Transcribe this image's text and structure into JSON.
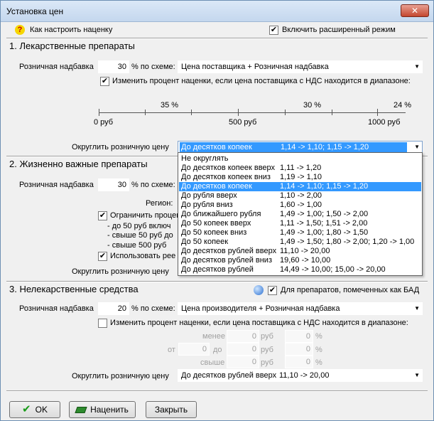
{
  "window": {
    "title": "Установка цен",
    "close_label": "✕"
  },
  "top": {
    "help_link": "Как настроить наценку",
    "help_icon": "question-icon",
    "extended_mode": {
      "label": "Включить расширенный режим",
      "checked": true
    }
  },
  "s1": {
    "header": "1. Лекарственные препараты",
    "markup_label": "Розничная надбавка",
    "markup_value": "30",
    "scheme_label": "% по схеме:",
    "scheme_value": "Цена поставщика + Розничная надбавка",
    "change_checkbox": {
      "label": "Изменить процент наценки, если цена поставщика с НДС находится в диапазоне:",
      "checked": true
    },
    "scale": {
      "percents": [
        "35 %",
        "30 %",
        "24 %"
      ],
      "prices": [
        "0 руб",
        "500 руб",
        "1000 руб"
      ]
    },
    "round_label": "Округлить розничную цену",
    "round_name": "До десятков копеек",
    "round_value": "1,14 -> 1,10;   1,15 -> 1,20"
  },
  "s2": {
    "header": "2. Жизненно важные препараты",
    "markup_label": "Розничная надбавка",
    "markup_value": "30",
    "scheme_label": "% по схеме:",
    "region_label": "Регион:",
    "limit_label": "Ограничить процен",
    "limit_checked": true,
    "lines": [
      "- до 50 руб  включ",
      "- свыше 50 руб до",
      "- свыше 500 руб"
    ],
    "use_label": "Использовать рее",
    "use_checked": true,
    "round_label": "Округлить розничную цену"
  },
  "dropdown": {
    "options": [
      {
        "name": "Не округлять",
        "value": ""
      },
      {
        "name": "До десятков копеек вверх",
        "value": "1,11 -> 1,20"
      },
      {
        "name": "До десятков копеек вниз",
        "value": "1,19 -> 1,10"
      },
      {
        "name": "До десятков копеек",
        "value": "1,14 -> 1,10;   1,15 -> 1,20"
      },
      {
        "name": "До рубля вверх",
        "value": "1,10 -> 2,00"
      },
      {
        "name": "До рубля вниз",
        "value": "1,60 -> 1,00"
      },
      {
        "name": "До ближайшего рубля",
        "value": "1,49 -> 1,00;   1,50 -> 2,00"
      },
      {
        "name": "До 50 копеек вверх",
        "value": "1,11 -> 1,50;   1,51 -> 2,00"
      },
      {
        "name": "До 50 копеек вниз",
        "value": "1,49 -> 1,00;   1,80 -> 1,50"
      },
      {
        "name": "До 50 копеек",
        "value": "1,49 -> 1,50;   1,80 -> 2,00;   1,20 -> 1,00"
      },
      {
        "name": "До десятков рублей вверх",
        "value": "11,10 -> 20,00"
      },
      {
        "name": "До десятков рублей вниз",
        "value": "19,60 -> 10,00"
      },
      {
        "name": "До десятков рублей",
        "value": "14,49 -> 10,00;   15,00 -> 20,00"
      }
    ],
    "selected_index": 3
  },
  "s3": {
    "header": "3. Нелекарственные средства",
    "bad_checkbox": {
      "label": "Для препаратов, помеченных как БАД",
      "checked": true
    },
    "markup_label": "Розничная надбавка",
    "markup_value": "20",
    "scheme_label": "% по схеме:",
    "scheme_value": "Цена производителя + Розничная надбавка",
    "change_checkbox": {
      "label": "Изменить процент наценки, если цена поставщика с НДС находится в диапазоне:",
      "checked": false
    },
    "less_label": "менее",
    "from_label": "от",
    "to_label": "до",
    "over_label": "свыше",
    "rub": "руб",
    "pct": "%",
    "less_value": "0",
    "from_value": "0",
    "to_value": "0",
    "over_value": "0",
    "pct_values": [
      "0",
      "0",
      "0"
    ],
    "round_label": "Округлить розничную цену",
    "round_name": "До десятков рублей вверх",
    "round_value": "11,10 -> 20,00"
  },
  "buttons": {
    "ok": "OK",
    "apply": "Наценить",
    "close": "Закрыть"
  },
  "colors": {
    "selection": "#3399ff",
    "ok_check": "#1a9c1a"
  }
}
